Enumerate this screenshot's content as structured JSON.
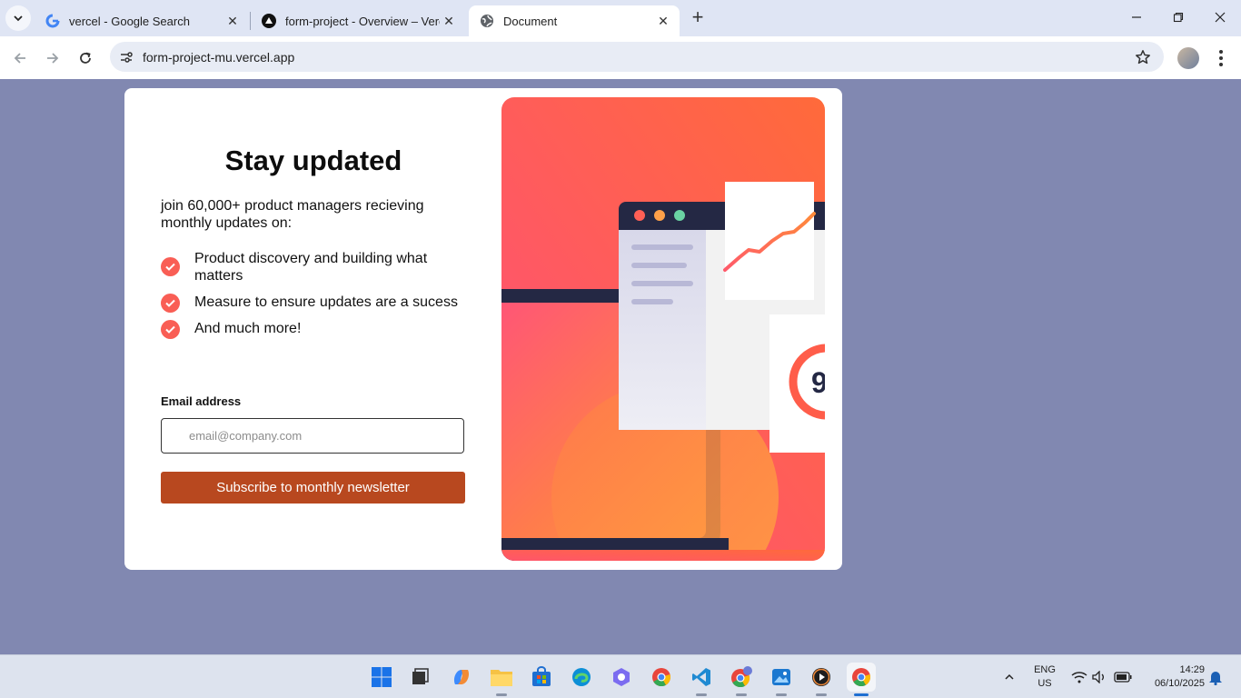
{
  "browser": {
    "tabs": [
      {
        "title": "vercel - Google Search",
        "favicon": "google-icon",
        "active": false
      },
      {
        "title": "form-project - Overview – Vercel",
        "favicon": "vercel-icon",
        "active": false
      },
      {
        "title": "Document",
        "favicon": "globe-icon",
        "active": true
      }
    ],
    "url": "form-project-mu.vercel.app"
  },
  "page": {
    "headline": "Stay updated",
    "intro": "join 60,000+ product managers recieving monthly updates on:",
    "features": [
      "Product discovery and building what matters",
      "Measure to ensure updates are a sucess",
      "And much more!"
    ],
    "email_label": "Email address",
    "email_placeholder": "email@company.com",
    "subscribe_label": "Subscribe to monthly newsletter",
    "illustration": {
      "gauge_text": "9"
    },
    "colors": {
      "accent": "#f95e55",
      "button": "#b8481f",
      "background": "#8188b1",
      "card": "#ffffff"
    }
  },
  "taskbar": {
    "apps": [
      "start-icon",
      "task-view-icon",
      "copilot-icon",
      "file-explorer-icon",
      "microsoft-store-icon",
      "edge-icon",
      "app-icon",
      "chrome-icon",
      "vscode-icon",
      "chrome-profile-icon",
      "photos-icon",
      "media-player-icon",
      "chrome-active-icon"
    ],
    "language": "ENG",
    "region": "US",
    "time": "14:29",
    "date": "06/10/2025"
  }
}
